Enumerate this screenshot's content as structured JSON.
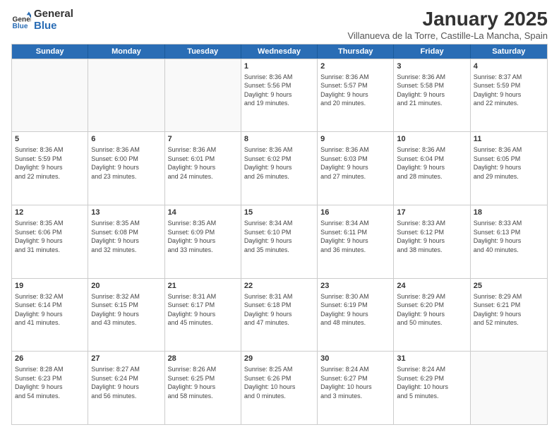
{
  "logo": {
    "general": "General",
    "blue": "Blue"
  },
  "title": "January 2025",
  "subtitle": "Villanueva de la Torre, Castille-La Mancha, Spain",
  "days_of_week": [
    "Sunday",
    "Monday",
    "Tuesday",
    "Wednesday",
    "Thursday",
    "Friday",
    "Saturday"
  ],
  "weeks": [
    [
      {
        "day": "",
        "info": ""
      },
      {
        "day": "",
        "info": ""
      },
      {
        "day": "",
        "info": ""
      },
      {
        "day": "1",
        "info": "Sunrise: 8:36 AM\nSunset: 5:56 PM\nDaylight: 9 hours\nand 19 minutes."
      },
      {
        "day": "2",
        "info": "Sunrise: 8:36 AM\nSunset: 5:57 PM\nDaylight: 9 hours\nand 20 minutes."
      },
      {
        "day": "3",
        "info": "Sunrise: 8:36 AM\nSunset: 5:58 PM\nDaylight: 9 hours\nand 21 minutes."
      },
      {
        "day": "4",
        "info": "Sunrise: 8:37 AM\nSunset: 5:59 PM\nDaylight: 9 hours\nand 22 minutes."
      }
    ],
    [
      {
        "day": "5",
        "info": "Sunrise: 8:36 AM\nSunset: 5:59 PM\nDaylight: 9 hours\nand 22 minutes."
      },
      {
        "day": "6",
        "info": "Sunrise: 8:36 AM\nSunset: 6:00 PM\nDaylight: 9 hours\nand 23 minutes."
      },
      {
        "day": "7",
        "info": "Sunrise: 8:36 AM\nSunset: 6:01 PM\nDaylight: 9 hours\nand 24 minutes."
      },
      {
        "day": "8",
        "info": "Sunrise: 8:36 AM\nSunset: 6:02 PM\nDaylight: 9 hours\nand 26 minutes."
      },
      {
        "day": "9",
        "info": "Sunrise: 8:36 AM\nSunset: 6:03 PM\nDaylight: 9 hours\nand 27 minutes."
      },
      {
        "day": "10",
        "info": "Sunrise: 8:36 AM\nSunset: 6:04 PM\nDaylight: 9 hours\nand 28 minutes."
      },
      {
        "day": "11",
        "info": "Sunrise: 8:36 AM\nSunset: 6:05 PM\nDaylight: 9 hours\nand 29 minutes."
      }
    ],
    [
      {
        "day": "12",
        "info": "Sunrise: 8:35 AM\nSunset: 6:06 PM\nDaylight: 9 hours\nand 31 minutes."
      },
      {
        "day": "13",
        "info": "Sunrise: 8:35 AM\nSunset: 6:08 PM\nDaylight: 9 hours\nand 32 minutes."
      },
      {
        "day": "14",
        "info": "Sunrise: 8:35 AM\nSunset: 6:09 PM\nDaylight: 9 hours\nand 33 minutes."
      },
      {
        "day": "15",
        "info": "Sunrise: 8:34 AM\nSunset: 6:10 PM\nDaylight: 9 hours\nand 35 minutes."
      },
      {
        "day": "16",
        "info": "Sunrise: 8:34 AM\nSunset: 6:11 PM\nDaylight: 9 hours\nand 36 minutes."
      },
      {
        "day": "17",
        "info": "Sunrise: 8:33 AM\nSunset: 6:12 PM\nDaylight: 9 hours\nand 38 minutes."
      },
      {
        "day": "18",
        "info": "Sunrise: 8:33 AM\nSunset: 6:13 PM\nDaylight: 9 hours\nand 40 minutes."
      }
    ],
    [
      {
        "day": "19",
        "info": "Sunrise: 8:32 AM\nSunset: 6:14 PM\nDaylight: 9 hours\nand 41 minutes."
      },
      {
        "day": "20",
        "info": "Sunrise: 8:32 AM\nSunset: 6:15 PM\nDaylight: 9 hours\nand 43 minutes."
      },
      {
        "day": "21",
        "info": "Sunrise: 8:31 AM\nSunset: 6:17 PM\nDaylight: 9 hours\nand 45 minutes."
      },
      {
        "day": "22",
        "info": "Sunrise: 8:31 AM\nSunset: 6:18 PM\nDaylight: 9 hours\nand 47 minutes."
      },
      {
        "day": "23",
        "info": "Sunrise: 8:30 AM\nSunset: 6:19 PM\nDaylight: 9 hours\nand 48 minutes."
      },
      {
        "day": "24",
        "info": "Sunrise: 8:29 AM\nSunset: 6:20 PM\nDaylight: 9 hours\nand 50 minutes."
      },
      {
        "day": "25",
        "info": "Sunrise: 8:29 AM\nSunset: 6:21 PM\nDaylight: 9 hours\nand 52 minutes."
      }
    ],
    [
      {
        "day": "26",
        "info": "Sunrise: 8:28 AM\nSunset: 6:23 PM\nDaylight: 9 hours\nand 54 minutes."
      },
      {
        "day": "27",
        "info": "Sunrise: 8:27 AM\nSunset: 6:24 PM\nDaylight: 9 hours\nand 56 minutes."
      },
      {
        "day": "28",
        "info": "Sunrise: 8:26 AM\nSunset: 6:25 PM\nDaylight: 9 hours\nand 58 minutes."
      },
      {
        "day": "29",
        "info": "Sunrise: 8:25 AM\nSunset: 6:26 PM\nDaylight: 10 hours\nand 0 minutes."
      },
      {
        "day": "30",
        "info": "Sunrise: 8:24 AM\nSunset: 6:27 PM\nDaylight: 10 hours\nand 3 minutes."
      },
      {
        "day": "31",
        "info": "Sunrise: 8:24 AM\nSunset: 6:29 PM\nDaylight: 10 hours\nand 5 minutes."
      },
      {
        "day": "",
        "info": ""
      }
    ]
  ]
}
